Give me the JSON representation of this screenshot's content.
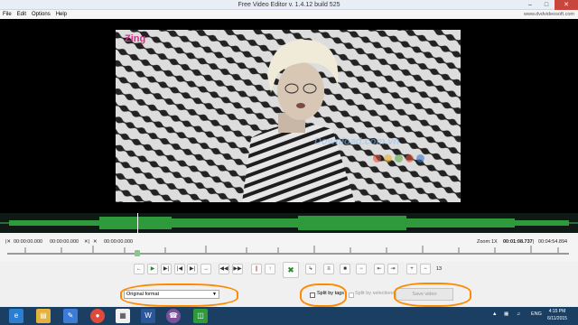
{
  "window": {
    "title": "Free Video Editor v. 1.4.12 build 525",
    "controls": [
      "minimize",
      "maximize",
      "close"
    ]
  },
  "menu": [
    "File",
    "Edit",
    "Options",
    "Help"
  ],
  "site_link": "www.dvdvideosoft.com",
  "video": {
    "logo_text": "Zing",
    "watermark": "Download.com.vn"
  },
  "timeline": {
    "start_time": "00:00:00.000",
    "sel_start": "00:00:00.000",
    "sel_end": "00:00:00.000",
    "zoom_label": "Zoom:",
    "zoom_value": "1X",
    "current_time": "00:01:08.737",
    "total_time": "00:04:54.894"
  },
  "controls": {
    "zoom_number": "13",
    "icons": [
      "prev-frame-icon",
      "play-icon",
      "play-selection-icon",
      "go-start-icon",
      "go-marker-icon",
      "next-frame-icon",
      "skip-back-icon",
      "skip-forward-icon",
      "marker-a-icon",
      "marker-b-icon",
      "cut-icon",
      "trim-icon",
      "split-icon",
      "delete-icon",
      "rewind-icon",
      "forward-icon",
      "zoom-in-icon",
      "zoom-out-icon"
    ]
  },
  "bottom": {
    "format": "Original format",
    "split_by_tags": "Split by tags",
    "split_by_selections": "Split by selections",
    "save": "Save video"
  },
  "taskbar": {
    "language": "ENG",
    "time": "4:15 PM",
    "date": "6/11/2015",
    "apps": [
      "ie-icon",
      "explorer-icon",
      "chrome-icon",
      "notepad-icon",
      "chart-app-icon",
      "word-icon",
      "viber-icon",
      "video-editor-icon"
    ]
  },
  "colors": {
    "accent": "#ff8a00",
    "taskbar": "#1b3f63",
    "waveform": "#2f9a3c"
  }
}
